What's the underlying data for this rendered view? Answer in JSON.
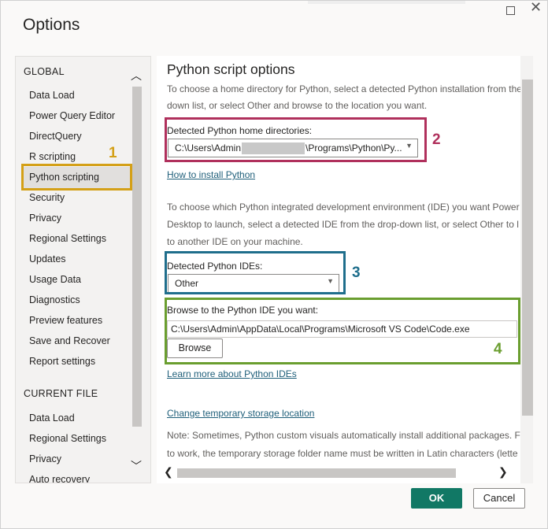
{
  "window": {
    "title": "Options"
  },
  "nav": {
    "global_heading": "GLOBAL",
    "global_items": [
      "Data Load",
      "Power Query Editor",
      "DirectQuery",
      "R scripting",
      "Python scripting",
      "Security",
      "Privacy",
      "Regional Settings",
      "Updates",
      "Usage Data",
      "Diagnostics",
      "Preview features",
      "Save and Recover",
      "Report settings"
    ],
    "selected": "Python scripting",
    "current_file_heading": "CURRENT FILE",
    "current_file_items": [
      "Data Load",
      "Regional Settings",
      "Privacy",
      "Auto recovery"
    ]
  },
  "content": {
    "title": "Python script options",
    "intro_line1": "To choose a home directory for Python, select a detected Python installation from the",
    "intro_line2": "down list, or select Other and browse to the location you want.",
    "home_dirs_label": "Detected Python home directories:",
    "home_dir_prefix": "C:\\Users\\Admin",
    "home_dir_suffix": "\\Programs\\Python\\Py...",
    "install_link": "How to install Python",
    "ide_para_line1": "To choose which Python integrated development environment (IDE) you want Power",
    "ide_para_line2": "Desktop to launch, select a detected IDE from the drop-down list, or select Other to l",
    "ide_para_line3": "to another IDE on your machine.",
    "ide_label": "Detected Python IDEs:",
    "ide_value": "Other",
    "browse_label": "Browse to the Python IDE you want:",
    "browse_path": "C:\\Users\\Admin\\AppData\\Local\\Programs\\Microsoft VS Code\\Code.exe",
    "browse_button": "Browse",
    "learn_link": "Learn more about Python IDEs",
    "storage_link": "Change temporary storage location",
    "note_line1": "Note: Sometimes, Python custom visuals automatically install additional packages. Fo",
    "note_line2": "to work, the temporary storage folder name must be written in Latin characters (lette"
  },
  "annotations": [
    {
      "number": "1",
      "color": "#d4a017"
    },
    {
      "number": "2",
      "color": "#b0305c"
    },
    {
      "number": "3",
      "color": "#1f6e8c"
    },
    {
      "number": "4",
      "color": "#6a9e2f"
    }
  ],
  "footer": {
    "ok": "OK",
    "cancel": "Cancel"
  },
  "colors": {
    "ok_button": "#117865",
    "link": "#1f5f7a"
  }
}
